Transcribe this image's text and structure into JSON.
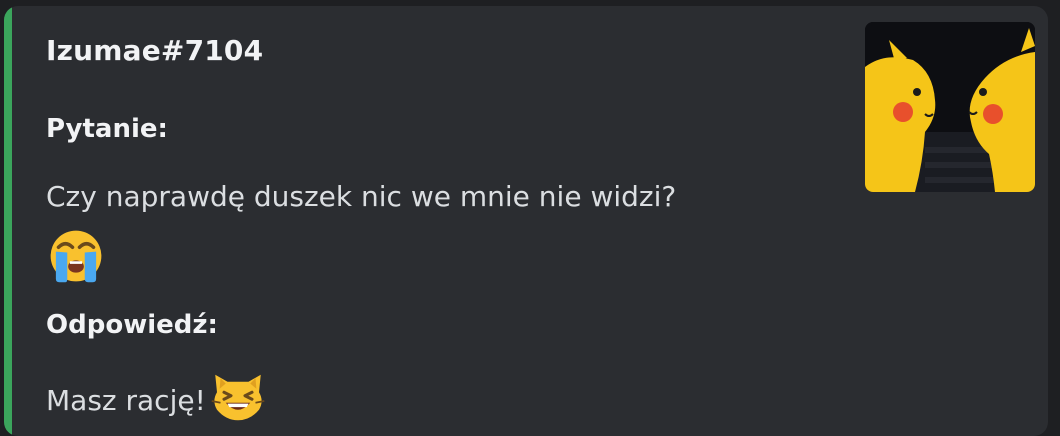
{
  "embed": {
    "accent_color": "#3ba55c",
    "author": "Izumae#7104",
    "thumbnail_icon": "pikachu-thumbnail",
    "fields": [
      {
        "name": "Pytanie:",
        "value": "Czy naprawdę duszek nic we mnie nie widzi?",
        "emoji": "loudly-crying-face-icon"
      },
      {
        "name": "Odpowiedź:",
        "value": "Masz rację!",
        "emoji": "grinning-cat-squinting-eyes-icon"
      }
    ]
  }
}
